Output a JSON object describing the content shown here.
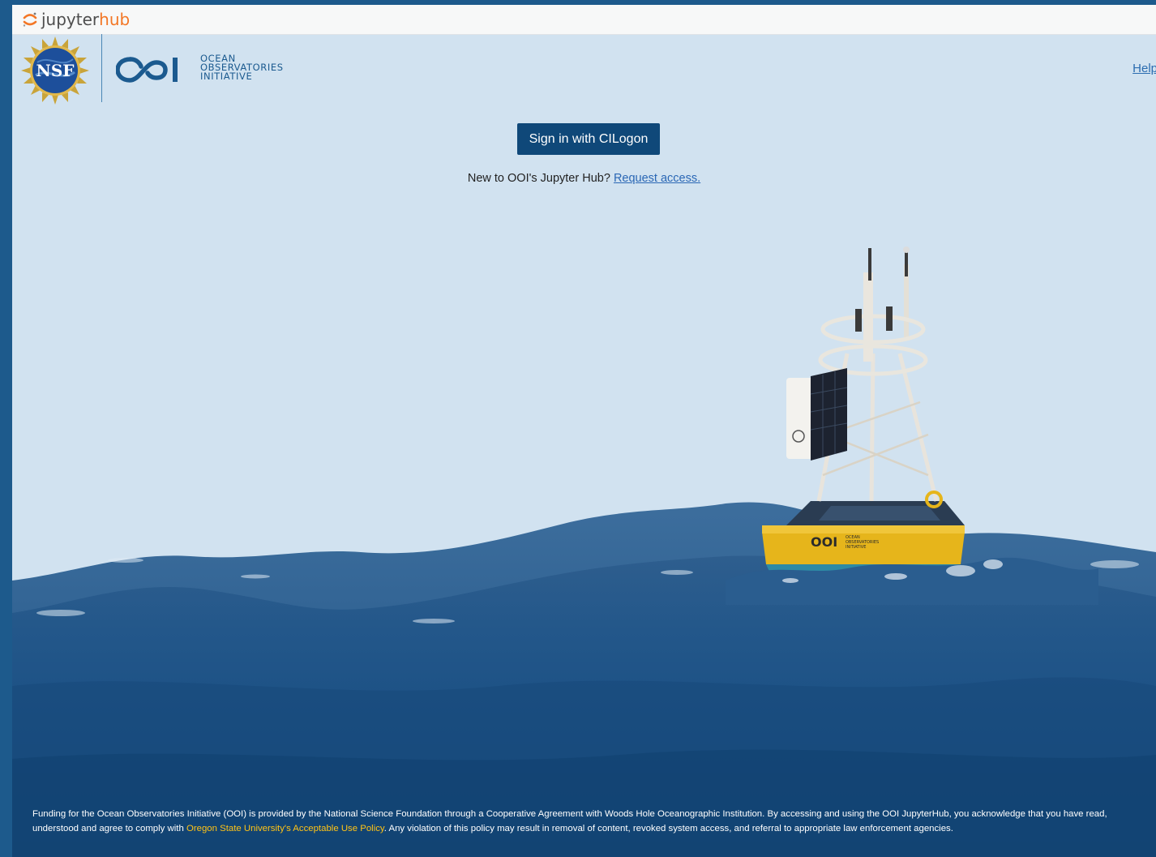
{
  "topbar": {
    "brand_jupyter": "jupyter",
    "brand_hub": "hub"
  },
  "brand": {
    "nsf_seal_text": "NSF",
    "ooi_line1": "OCEAN",
    "ooi_line2": "OBSERVATORIES",
    "ooi_line3": "INITIATIVE",
    "buoy_logo_line1": "OCEAN",
    "buoy_logo_line2": "OBSERVATORIES",
    "buoy_logo_line3": "INITIATIVE"
  },
  "nav": {
    "help_label": "Help"
  },
  "login": {
    "signin_label": "Sign in with CILogon",
    "new_prefix": "New to OOI's Jupyter Hub?",
    "request_access_label": "Request access."
  },
  "footer": {
    "text_before_link": "Funding for the Ocean Observatories Initiative (OOI) is provided by the National Science Foundation through a Cooperative Agreement with Woods Hole Oceanographic Institution. By accessing and using the OOI JupyterHub, you acknowledge that you have read, understood and agree to comply with ",
    "policy_link": "Oregon State University's Acceptable Use Policy",
    "text_after_link": ". Any violation of this policy may result in removal of content, revoked system access, and referral to appropriate law enforcement agencies."
  },
  "colors": {
    "background": "#d1e2f0",
    "button": "#0f4879",
    "jupyter_orange": "#f37726",
    "link_blue": "#2a67b5",
    "footer_link": "#ffc316",
    "buoy_yellow": "#e6b51b"
  },
  "icons": {
    "logo": "jupyter-logo-icon",
    "seal": "nsf-seal-icon",
    "ooi": "ooi-logo-icon",
    "hero": "buoy-on-waves-illustration"
  }
}
